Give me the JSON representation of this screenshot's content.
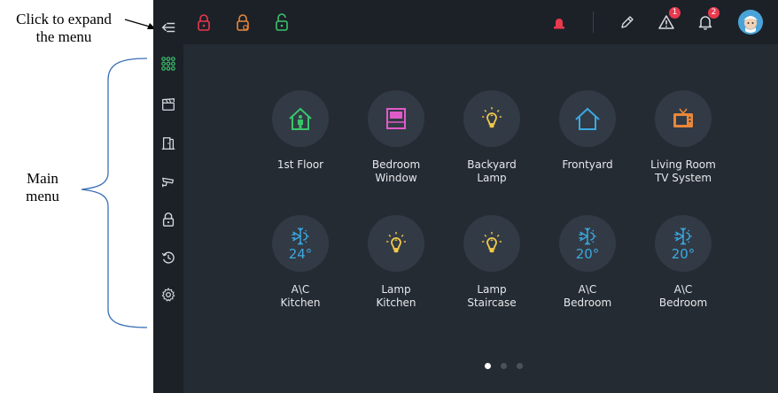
{
  "annotations": {
    "expand_line1": "Click to expand",
    "expand_line2": "the menu",
    "main_line1": "Main",
    "main_line2": "menu"
  },
  "sidebar": {
    "items": [
      {
        "name": "expand-menu",
        "icon": "menu-arrow-icon"
      },
      {
        "name": "dashboard",
        "icon": "grid-dots-icon",
        "color": "#3ac46a"
      },
      {
        "name": "scenes",
        "icon": "clapperboard-icon"
      },
      {
        "name": "doors",
        "icon": "door-icon"
      },
      {
        "name": "cameras",
        "icon": "camera-icon"
      },
      {
        "name": "locks",
        "icon": "lock-icon"
      },
      {
        "name": "history",
        "icon": "history-icon"
      },
      {
        "name": "settings",
        "icon": "gear-icon"
      }
    ]
  },
  "topbar": {
    "lock_colors": [
      "#e8394d",
      "#e8873a",
      "#3ac46a"
    ],
    "alarm_color": "#e8394d",
    "warning_count": "1",
    "notification_count": "2"
  },
  "tiles": [
    {
      "label_1": "1st Floor",
      "label_2": "",
      "icon": "house-person-icon",
      "color": "#3ac46a"
    },
    {
      "label_1": "Bedroom",
      "label_2": "Window",
      "icon": "window-icon",
      "color": "#e05bc8"
    },
    {
      "label_1": "Backyard",
      "label_2": "Lamp",
      "icon": "bulb-icon",
      "color": "#f2c94c"
    },
    {
      "label_1": "Frontyard",
      "label_2": "",
      "icon": "house-icon",
      "color": "#3ba9e0"
    },
    {
      "label_1": "Living Room",
      "label_2": "TV System",
      "icon": "tv-icon",
      "color": "#e8873a"
    },
    {
      "label_1": "A\\C",
      "label_2": "Kitchen",
      "icon": "ac-icon",
      "temp": "24°",
      "color": "#3ba9e0"
    },
    {
      "label_1": "Lamp",
      "label_2": "Kitchen",
      "icon": "bulb-icon",
      "color": "#f2c94c"
    },
    {
      "label_1": "Lamp",
      "label_2": "Staircase",
      "icon": "bulb-icon",
      "color": "#f2c94c"
    },
    {
      "label_1": "A\\C",
      "label_2": "Bedroom",
      "icon": "ac-icon",
      "temp": "20°",
      "color": "#3ba9e0"
    },
    {
      "label_1": "A\\C",
      "label_2": "Bedroom",
      "icon": "ac-icon",
      "temp": "20°",
      "color": "#3ba9e0"
    }
  ],
  "pagination": {
    "pages": 3,
    "active": 1
  }
}
